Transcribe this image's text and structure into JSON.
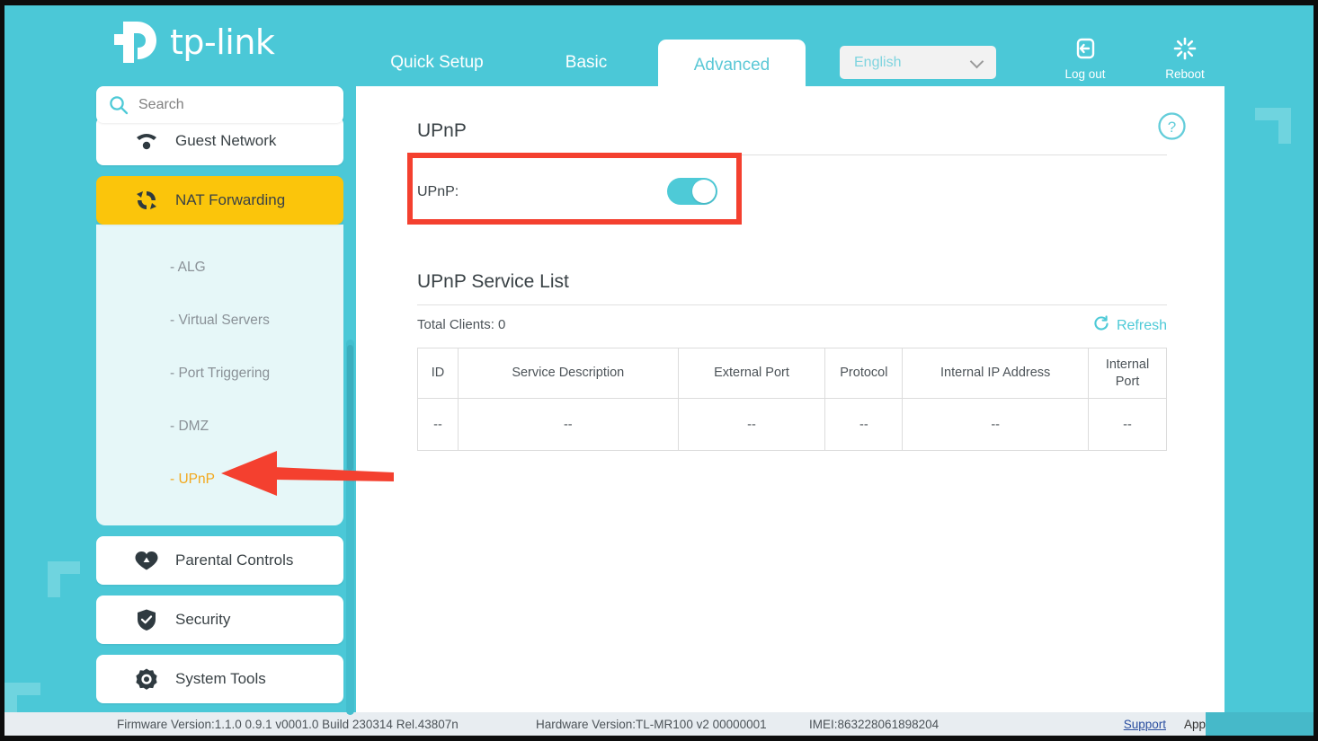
{
  "brand": {
    "name": "tp-link"
  },
  "header": {
    "tabs": [
      {
        "label": "Quick Setup",
        "active": false
      },
      {
        "label": "Basic",
        "active": false
      },
      {
        "label": "Advanced",
        "active": true
      }
    ],
    "language": {
      "value": "English"
    },
    "logout_label": "Log out",
    "reboot_label": "Reboot"
  },
  "sidebar": {
    "search_placeholder": "Search",
    "search_value": "",
    "items": [
      {
        "label": "Guest Network",
        "icon": "guest-network-icon",
        "active": false
      },
      {
        "label": "NAT Forwarding",
        "icon": "nat-forwarding-icon",
        "active": true
      },
      {
        "label": "Parental Controls",
        "icon": "parental-controls-icon",
        "active": false
      },
      {
        "label": "Security",
        "icon": "security-shield-icon",
        "active": false
      },
      {
        "label": "System Tools",
        "icon": "system-tools-icon",
        "active": false
      }
    ],
    "submenu": [
      {
        "label": "- ALG",
        "active": false
      },
      {
        "label": "- Virtual Servers",
        "active": false
      },
      {
        "label": "- Port Triggering",
        "active": false
      },
      {
        "label": "- DMZ",
        "active": false
      },
      {
        "label": "- UPnP",
        "active": true
      }
    ]
  },
  "main": {
    "section1_title": "UPnP",
    "upnp_row_label": "UPnP:",
    "upnp_toggle_state": "on",
    "section2_title": "UPnP Service List",
    "total_clients": "Total Clients: 0",
    "refresh_label": "Refresh",
    "table": {
      "columns": [
        "ID",
        "Service Description",
        "External Port",
        "Protocol",
        "Internal IP Address",
        "Internal Port"
      ],
      "rows": [
        [
          "--",
          "--",
          "--",
          "--",
          "--",
          "--"
        ]
      ]
    }
  },
  "footer": {
    "firmware": "Firmware Version:1.1.0 0.9.1 v0001.0 Build 230314 Rel.43807n",
    "hardware": "Hardware Version:TL-MR100 v2 00000001",
    "imei": "IMEI:863228061898204",
    "support": "Support",
    "app": "App"
  },
  "colors": {
    "brand_teal": "#4BC8D7",
    "accent_amber": "#FBC50B",
    "submenu_active": "#F2A81D",
    "annotation_red": "#F4402F",
    "toggle_on": "#4ECAD7"
  }
}
